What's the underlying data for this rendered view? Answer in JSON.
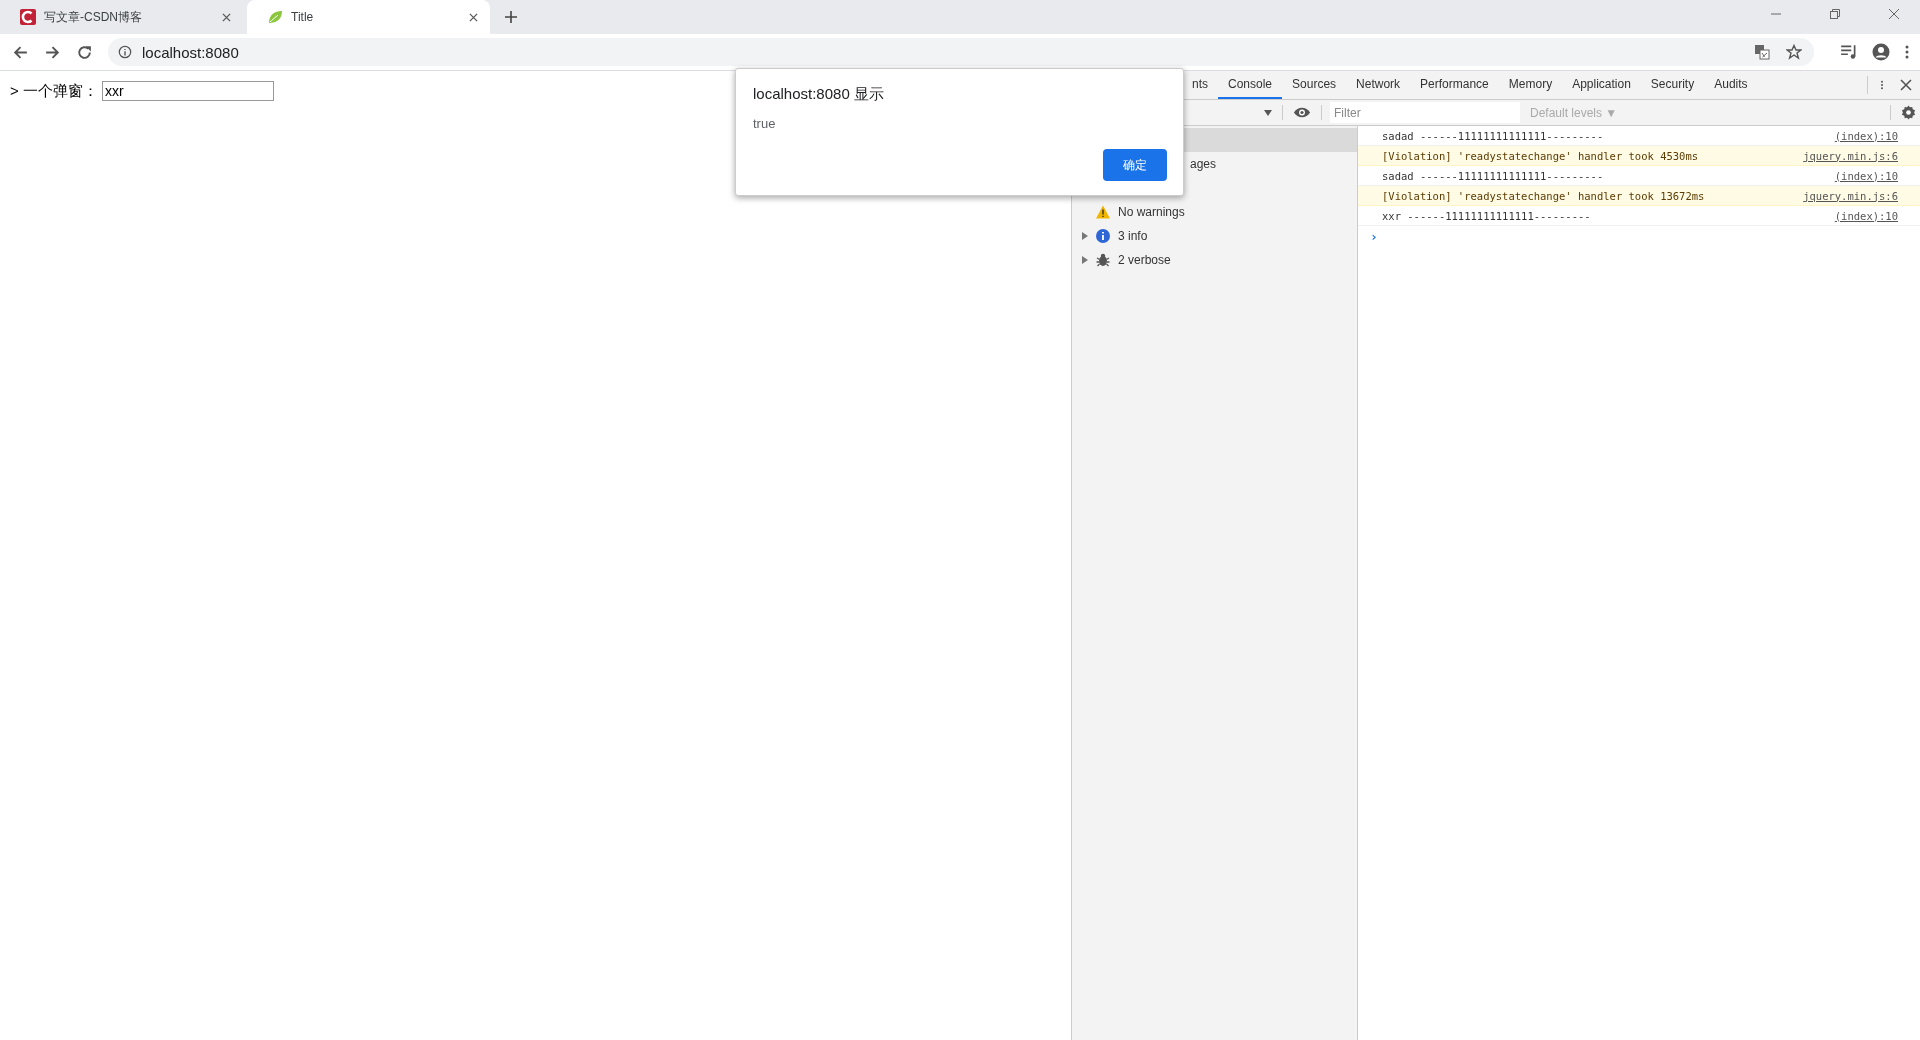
{
  "browser_tabs": [
    {
      "title": "写文章-CSDN博客",
      "kind": "csdn",
      "selected": false
    },
    {
      "title": "Title",
      "kind": "leaf",
      "selected": true
    }
  ],
  "address_bar": {
    "url": "localhost:8080"
  },
  "page": {
    "label": "> 一个弹窗：",
    "input_value": "xxr"
  },
  "devtools": {
    "tabs": [
      {
        "label": "nts",
        "selected": false
      },
      {
        "label": "Console",
        "selected": true
      },
      {
        "label": "Sources",
        "selected": false
      },
      {
        "label": "Network",
        "selected": false
      },
      {
        "label": "Performance",
        "selected": false
      },
      {
        "label": "Memory",
        "selected": false
      },
      {
        "label": "Application",
        "selected": false
      },
      {
        "label": "Security",
        "selected": false
      },
      {
        "label": "Audits",
        "selected": false
      }
    ],
    "filter": {
      "placeholder": "Filter"
    },
    "levels": {
      "label": "Default levels ▼"
    },
    "sidebar": {
      "items": [
        {
          "kind": "plain",
          "selected": true
        },
        {
          "kind": "plain",
          "label": "ages",
          "selected": false
        },
        {
          "kind": "plain",
          "selected": false
        },
        {
          "kind": "warning",
          "label": "No warnings",
          "selected": false,
          "expandable": false
        },
        {
          "kind": "info",
          "label": "3 info",
          "selected": false,
          "expandable": true
        },
        {
          "kind": "verbose",
          "label": "2 verbose",
          "selected": false,
          "expandable": true
        }
      ]
    },
    "messages": [
      {
        "kind": "log",
        "text": "sadad ------11111111111111---------",
        "source": "(index):10"
      },
      {
        "kind": "violation",
        "text": "[Violation] 'readystatechange' handler took 4530ms",
        "source": "jquery.min.js:6"
      },
      {
        "kind": "log",
        "text": "sadad ------11111111111111---------",
        "source": "(index):10"
      },
      {
        "kind": "violation",
        "text": "[Violation] 'readystatechange' handler took 13672ms",
        "source": "jquery.min.js:6"
      },
      {
        "kind": "log",
        "text": "xxr ------11111111111111---------",
        "source": "(index):10"
      }
    ],
    "prompt": "›"
  },
  "dialog": {
    "title": "localhost:8080 显示",
    "message": "true",
    "button": "确定"
  }
}
